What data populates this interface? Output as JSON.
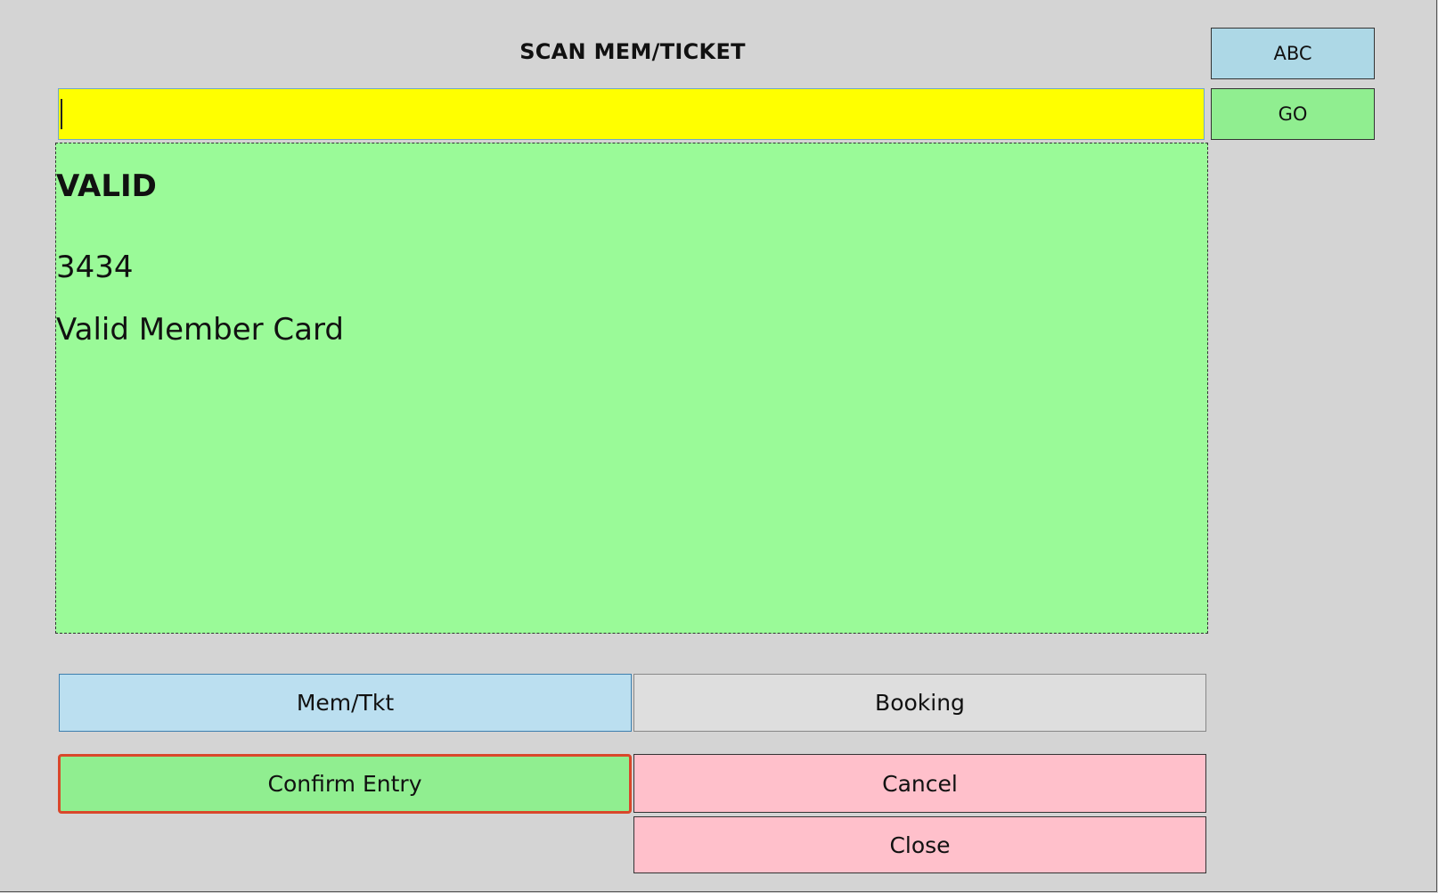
{
  "header": {
    "title": "SCAN MEM/TICKET"
  },
  "scan": {
    "input_value": "",
    "placeholder": ""
  },
  "side_buttons": {
    "abc_label": "ABC",
    "go_label": "GO"
  },
  "result": {
    "status": "VALID",
    "number": "3434",
    "message": "Valid Member Card"
  },
  "mode_buttons": {
    "memtkt_label": "Mem/Tkt",
    "booking_label": "Booking"
  },
  "action_buttons": {
    "confirm_label": "Confirm Entry",
    "cancel_label": "Cancel",
    "close_label": "Close"
  },
  "colors": {
    "background": "#d4d4d4",
    "input_bg": "#ffff00",
    "result_bg": "#9afa98",
    "go_bg": "#90ee90",
    "abc_bg": "#add8e6",
    "memtkt_bg": "#bbdff0",
    "booking_bg": "#dedede",
    "confirm_bg": "#90ee90",
    "confirm_focus_border": "#d9472b",
    "cancel_bg": "#ffc0cb",
    "close_bg": "#ffc0cb"
  }
}
